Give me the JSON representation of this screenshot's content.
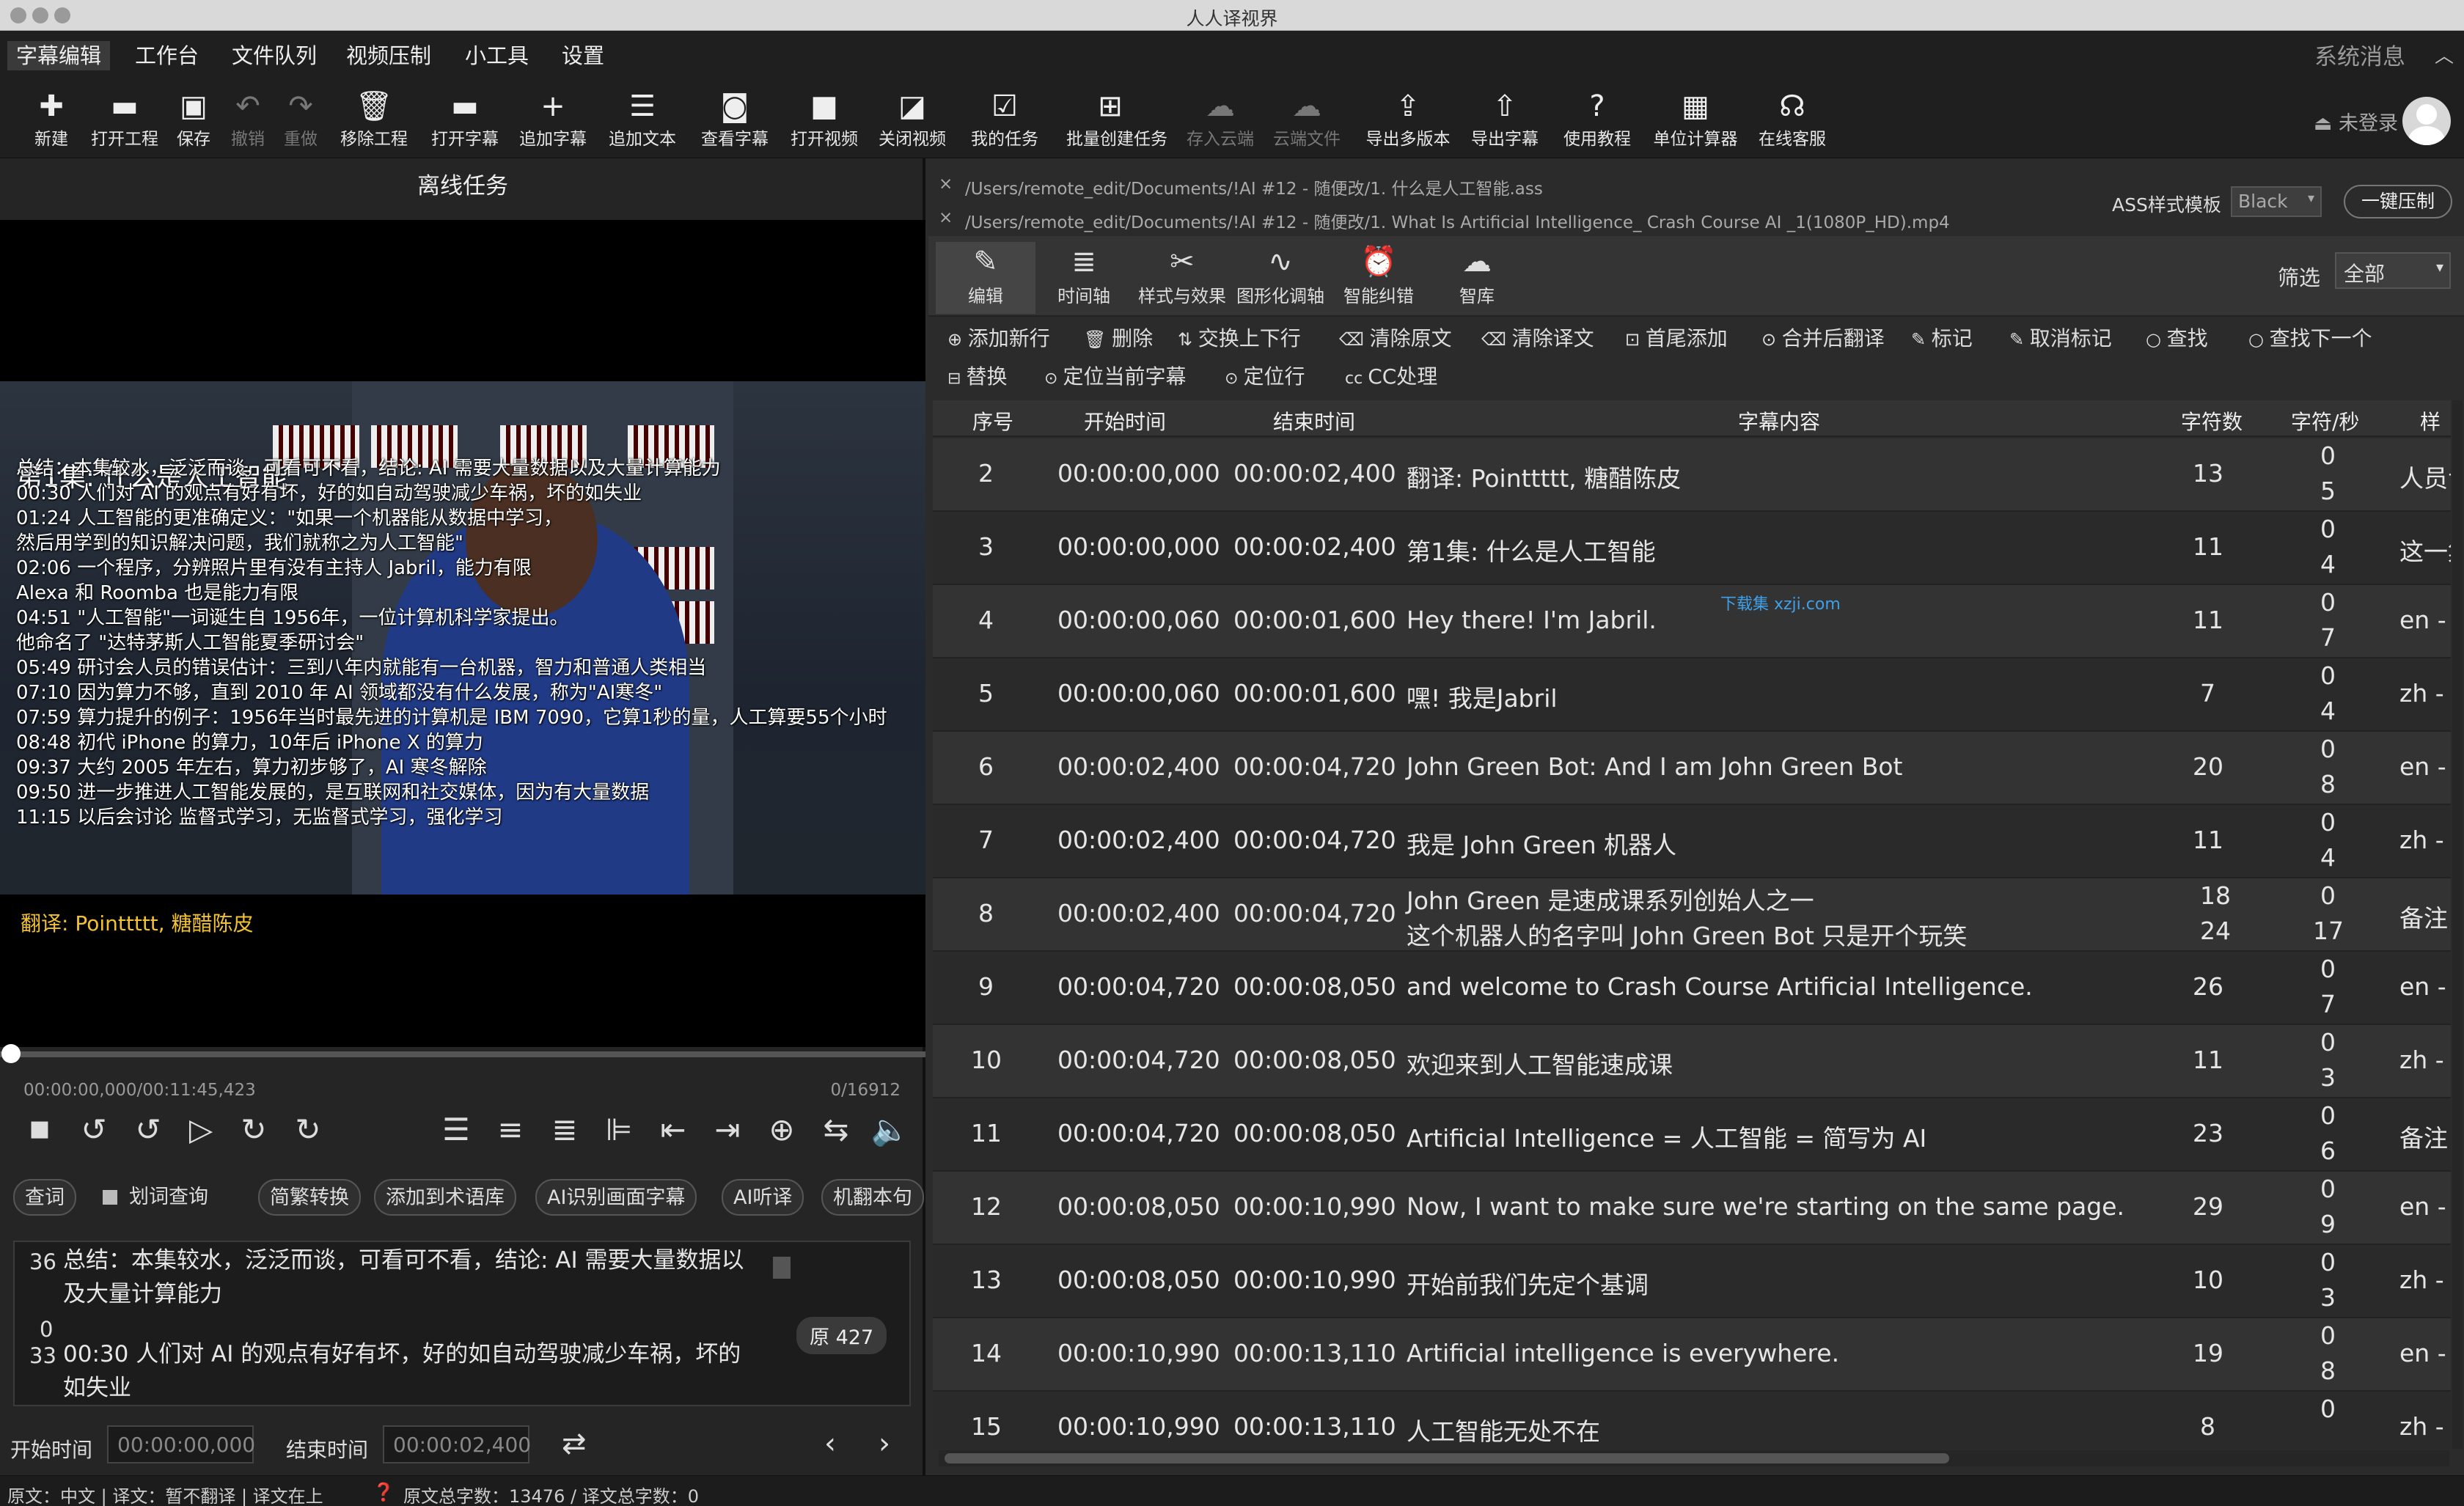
{
  "window_title": "人人译视界",
  "menu": [
    "字幕编辑",
    "工作台",
    "文件队列",
    "视频压制",
    "小工具",
    "设置"
  ],
  "system_messages": "系统消息",
  "toolbar": [
    {
      "label": "新建",
      "icon": "new-file-icon",
      "glyph": "✚",
      "enabled": true
    },
    {
      "label": "打开工程",
      "icon": "open-project-icon",
      "glyph": "▬",
      "enabled": true
    },
    {
      "label": "保存",
      "icon": "save-icon",
      "glyph": "▣",
      "enabled": true
    },
    {
      "label": "撤销",
      "icon": "undo-icon",
      "glyph": "↶",
      "enabled": false
    },
    {
      "label": "重做",
      "icon": "redo-icon",
      "glyph": "↷",
      "enabled": false
    },
    {
      "label": "移除工程",
      "icon": "trash-icon",
      "glyph": "🗑",
      "enabled": true
    },
    {
      "label": "打开字幕",
      "icon": "open-subtitle-icon",
      "glyph": "▬",
      "enabled": true
    },
    {
      "label": "追加字幕",
      "icon": "plus-icon",
      "glyph": "+",
      "enabled": true
    },
    {
      "label": "追加文本",
      "icon": "text-doc-icon",
      "glyph": "☰",
      "enabled": true
    },
    {
      "label": "查看字幕",
      "icon": "view-subtitle-icon",
      "glyph": "◙",
      "enabled": true
    },
    {
      "label": "打开视频",
      "icon": "video-camera-icon",
      "glyph": "■",
      "enabled": true
    },
    {
      "label": "关闭视频",
      "icon": "video-off-icon",
      "glyph": "◪",
      "enabled": true
    },
    {
      "label": "我的任务",
      "icon": "task-clipboard-icon",
      "glyph": "☑",
      "enabled": true
    },
    {
      "label": "批量创建任务",
      "icon": "batch-task-icon",
      "glyph": "⊞",
      "enabled": true
    },
    {
      "label": "存入云端",
      "icon": "cloud-save-icon",
      "glyph": "☁",
      "enabled": false
    },
    {
      "label": "云端文件",
      "icon": "cloud-file-icon",
      "glyph": "☁",
      "enabled": false
    },
    {
      "label": "导出多版本",
      "icon": "export-layers-icon",
      "glyph": "⇪",
      "enabled": true
    },
    {
      "label": "导出字幕",
      "icon": "export-subtitle-icon",
      "glyph": "⇧",
      "enabled": true
    },
    {
      "label": "使用教程",
      "icon": "help-icon",
      "glyph": "?",
      "enabled": true
    },
    {
      "label": "单位计算器",
      "icon": "calculator-icon",
      "glyph": "▦",
      "enabled": true
    },
    {
      "label": "在线客服",
      "icon": "headset-icon",
      "glyph": "☊",
      "enabled": true
    }
  ],
  "login_text": "未登录",
  "left": {
    "offline_title": "离线任务",
    "overlay": {
      "title": "第1集: 什么是人工智能",
      "lines": [
        "总结：本集较水，泛泛而谈，可看可不看，结论: AI 需要大量数据以及大量计算能力",
        "00:30 人们对 AI 的观点有好有坏，好的如自动驾驶减少车祸，坏的如失业",
        "01:24 人工智能的更准确定义：\"如果一个机器能从数据中学习，",
        "然后用学到的知识解决问题，我们就称之为人工智能\"",
        "02:06 一个程序，分辨照片里有没有主持人 Jabril，能力有限",
        "Alexa 和 Roomba 也是能力有限",
        "04:51 \"人工智能\"一词诞生自 1956年，一位计算机科学家提出。",
        "他命名了 \"达特茅斯人工智能夏季研讨会\"",
        "05:49  研讨会人员的错误估计：三到八年内就能有一台机器，智力和普通人类相当",
        "07:10  因为算力不够，直到 2010 年 AI 领域都没有什么发展，称为\"AI寒冬\"",
        "07:59  算力提升的例子：1956年当时最先进的计算机是 IBM 7090，它算1秒的量，人工算要55个小时",
        "08:48  初代 iPhone 的算力，10年后 iPhone X 的算力",
        "09:37  大约 2005 年左右，算力初步够了，AI 寒冬解除",
        "09:50  进一步推进人工智能发展的，是互联网和社交媒体，因为有大量数据",
        "11:15  以后会讨论 监督式学习，无监督式学习，强化学习"
      ],
      "translator": "翻译: Pointtttt, 糖醋陈皮"
    },
    "time_current": "00:00:00,000/00:11:45,423",
    "frame_counter": "0/16912",
    "playback_progress": 0,
    "feature_buttons": [
      "查词",
      "划词查询",
      "简繁转换",
      "添加到术语库",
      "AI识别画面字幕",
      "AI听译",
      "机翻本句"
    ],
    "editor": {
      "line1_count": "36",
      "line1_text_a": "总结：本集较水，泛泛而谈，可看可不看，结论: AI 需要大量数据以",
      "line1_text_b": "及大量计算能力",
      "line2_count": "0",
      "line3_count": "33",
      "line3_text_a": "00:30 人们对 AI 的观点有好有坏，好的如自动驾驶减少车祸，坏的",
      "line3_text_b": "如失业",
      "original_badge": "原 427"
    },
    "start_label": "开始时间",
    "start_value": "00:00:00,000",
    "end_label": "结束时间",
    "end_value": "00:00:02,400"
  },
  "status_left": "原文：中文 | 译文：暂不翻译 | 译文在上",
  "status_right": "原文总字数：13476 / 译文总字数：0",
  "right": {
    "files": [
      "/Users/remote_edit/Documents/!AI #12 - 随便改/1. 什么是人工智能.ass",
      "/Users/remote_edit/Documents/!AI #12 - 随便改/1. What Is Artificial Intelligence_ Crash Course AI _1(1080P_HD).mp4"
    ],
    "ass_template_label": "ASS样式模板",
    "ass_template_value": "Black",
    "compress_button": "一键压制",
    "tabs": [
      {
        "label": "编辑",
        "icon": "pencil-icon",
        "glyph": "✎"
      },
      {
        "label": "时间轴",
        "icon": "timeline-icon",
        "glyph": "≣"
      },
      {
        "label": "样式与效果",
        "icon": "tools-icon",
        "glyph": "✂"
      },
      {
        "label": "图形化调轴",
        "icon": "graph-icon",
        "glyph": "∿"
      },
      {
        "label": "智能纠错",
        "icon": "alarm-icon",
        "glyph": "⏰"
      },
      {
        "label": "智库",
        "icon": "brain-icon",
        "glyph": "☁"
      }
    ],
    "filter_label": "筛选",
    "filter_value": "全部",
    "actions_row1": [
      "添加新行",
      "删除",
      "交换上下行",
      "清除原文",
      "清除译文",
      "首尾添加",
      "合并后翻译",
      "标记",
      "取消标记",
      "查找",
      "查找下一个"
    ],
    "actions_row2": [
      "替换",
      "定位当前字幕",
      "定位行",
      "CC处理"
    ],
    "columns": [
      "序号",
      "开始时间",
      "结束时间",
      "字幕内容",
      "字符数",
      "字符/秒",
      "样"
    ],
    "rows": [
      {
        "n": "2",
        "start": "00:00:00,000",
        "end": "00:00:02,400",
        "text": "翻译: Pointtttt, 糖醋陈皮",
        "chars": "13",
        "cps_top": "0",
        "cps_bot": "5",
        "style": "人员专"
      },
      {
        "n": "3",
        "start": "00:00:00,000",
        "end": "00:00:02,400",
        "text": "第1集: 什么是人工智能",
        "chars": "11",
        "cps_top": "0",
        "cps_bot": "4",
        "style": "这一集"
      },
      {
        "n": "4",
        "start": "00:00:00,060",
        "end": "00:00:01,600",
        "text": "Hey there! I'm Jabril.",
        "chars": "11",
        "cps_top": "0",
        "cps_bot": "7",
        "style": "en -"
      },
      {
        "n": "5",
        "start": "00:00:00,060",
        "end": "00:00:01,600",
        "text": "嘿! 我是Jabril",
        "chars": "7",
        "cps_top": "0",
        "cps_bot": "4",
        "style": "zh -"
      },
      {
        "n": "6",
        "start": "00:00:02,400",
        "end": "00:00:04,720",
        "text": "John Green Bot: And I am John Green Bot",
        "chars": "20",
        "cps_top": "0",
        "cps_bot": "8",
        "style": "en -"
      },
      {
        "n": "7",
        "start": "00:00:02,400",
        "end": "00:00:04,720",
        "text": "我是 John Green 机器人",
        "chars": "11",
        "cps_top": "0",
        "cps_bot": "4",
        "style": "zh -"
      },
      {
        "n": "8",
        "start": "00:00:02,400",
        "end": "00:00:04,720",
        "text": "John Green 是速成课系列创始人之一",
        "text2": " 这个机器人的名字叫 John Green Bot 只是开个玩笑",
        "chars": "18",
        "chars2": "24",
        "cps_top": "0",
        "cps_bot": "17",
        "style": "备注 -"
      },
      {
        "n": "9",
        "start": "00:00:04,720",
        "end": "00:00:08,050",
        "text": "and welcome to Crash Course Artificial Intelligence.",
        "chars": "26",
        "cps_top": "0",
        "cps_bot": "7",
        "style": "en -"
      },
      {
        "n": "10",
        "start": "00:00:04,720",
        "end": "00:00:08,050",
        "text": "欢迎来到人工智能速成课",
        "chars": "11",
        "cps_top": "0",
        "cps_bot": "3",
        "style": "zh -"
      },
      {
        "n": "11",
        "start": "00:00:04,720",
        "end": "00:00:08,050",
        "text": "Artificial Intelligence = 人工智能 = 简写为 AI",
        "chars": "23",
        "cps_top": "0",
        "cps_bot": "6",
        "style": "备注 -"
      },
      {
        "n": "12",
        "start": "00:00:08,050",
        "end": "00:00:10,990",
        "text": "Now, I want to make sure we're starting on the same page.",
        "chars": "29",
        "cps_top": "0",
        "cps_bot": "9",
        "style": "en -"
      },
      {
        "n": "13",
        "start": "00:00:08,050",
        "end": "00:00:10,990",
        "text": "开始前我们先定个基调",
        "chars": "10",
        "cps_top": "0",
        "cps_bot": "3",
        "style": "zh -"
      },
      {
        "n": "14",
        "start": "00:00:10,990",
        "end": "00:00:13,110",
        "text": "Artificial intelligence is everywhere.",
        "chars": "19",
        "cps_top": "0",
        "cps_bot": "8",
        "style": "en -"
      },
      {
        "n": "15",
        "start": "00:00:10,990",
        "end": "00:00:13,110",
        "text": "人工智能无处不在",
        "chars": "8",
        "cps_top": "0",
        "cps_bot": "",
        "style": "zh -"
      }
    ],
    "watermark": "下载集 xzji.com"
  },
  "colors": {
    "accent_yellow": "#f2c230",
    "panel_bg": "#2b2b2b",
    "row_alt": "#333333",
    "shirt_blue": "#203a86"
  }
}
